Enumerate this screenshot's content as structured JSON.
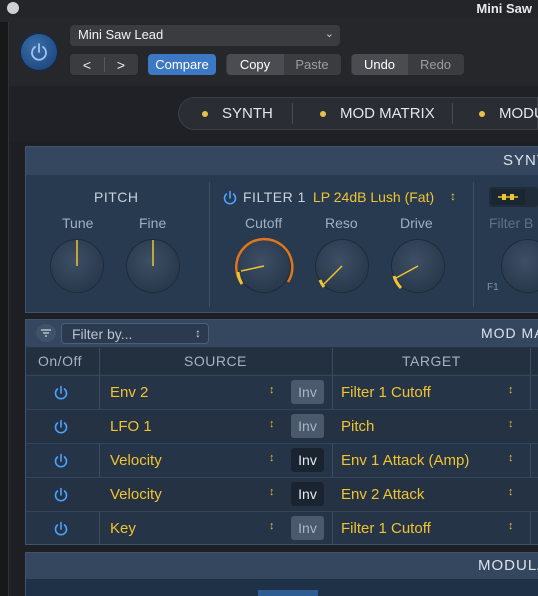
{
  "window": {
    "title": "Mini Saw"
  },
  "header": {
    "preset_name": "Mini Saw Lead",
    "nav_prev": "<",
    "nav_next": ">",
    "compare_label": "Compare",
    "copy_label": "Copy",
    "paste_label": "Paste",
    "undo_label": "Undo",
    "redo_label": "Redo"
  },
  "tabs": [
    {
      "label": "SYNTH"
    },
    {
      "label": "MOD MATRIX"
    },
    {
      "label": "MODU"
    }
  ],
  "synth": {
    "title": "SYNT",
    "pitch": {
      "label": "PITCH",
      "knobs": [
        {
          "label": "Tune",
          "value": 0.5
        },
        {
          "label": "Fine",
          "value": 0.5
        }
      ]
    },
    "filter1": {
      "label": "FILTER 1",
      "type": "LP 24dB Lush (Fat)",
      "knobs": [
        {
          "label": "Cutoff",
          "value": 0.35
        },
        {
          "label": "Reso",
          "value": 0.05
        },
        {
          "label": "Drive",
          "value": 0.1
        }
      ]
    },
    "filterB_label": "Filter B",
    "f1_label": "F1"
  },
  "mod_matrix": {
    "title": "MOD MA",
    "filter_placeholder": "Filter by...",
    "columns": {
      "onoff": "On/Off",
      "source": "SOURCE",
      "target": "TARGET"
    },
    "inv_label": "Inv",
    "rows": [
      {
        "source": "Env 2",
        "inv": false,
        "target": "Filter 1 Cutoff"
      },
      {
        "source": "LFO 1",
        "inv": false,
        "target": "Pitch"
      },
      {
        "source": "Velocity",
        "inv": true,
        "target": "Env 1 Attack (Amp)"
      },
      {
        "source": "Velocity",
        "inv": true,
        "target": "Env 2 Attack"
      },
      {
        "source": "Key",
        "inv": false,
        "target": "Filter 1 Cutoff"
      }
    ]
  },
  "modulators": {
    "title": "MODULA"
  },
  "icons": {
    "power": "power-icon",
    "filter": "filter-icon",
    "updown": "updown-chevron-icon"
  },
  "colors": {
    "accent_yellow": "#f0c431",
    "accent_blue": "#3d78c4",
    "cutoff_ring": "#e0761a",
    "power_blue": "#4aa3ff"
  }
}
